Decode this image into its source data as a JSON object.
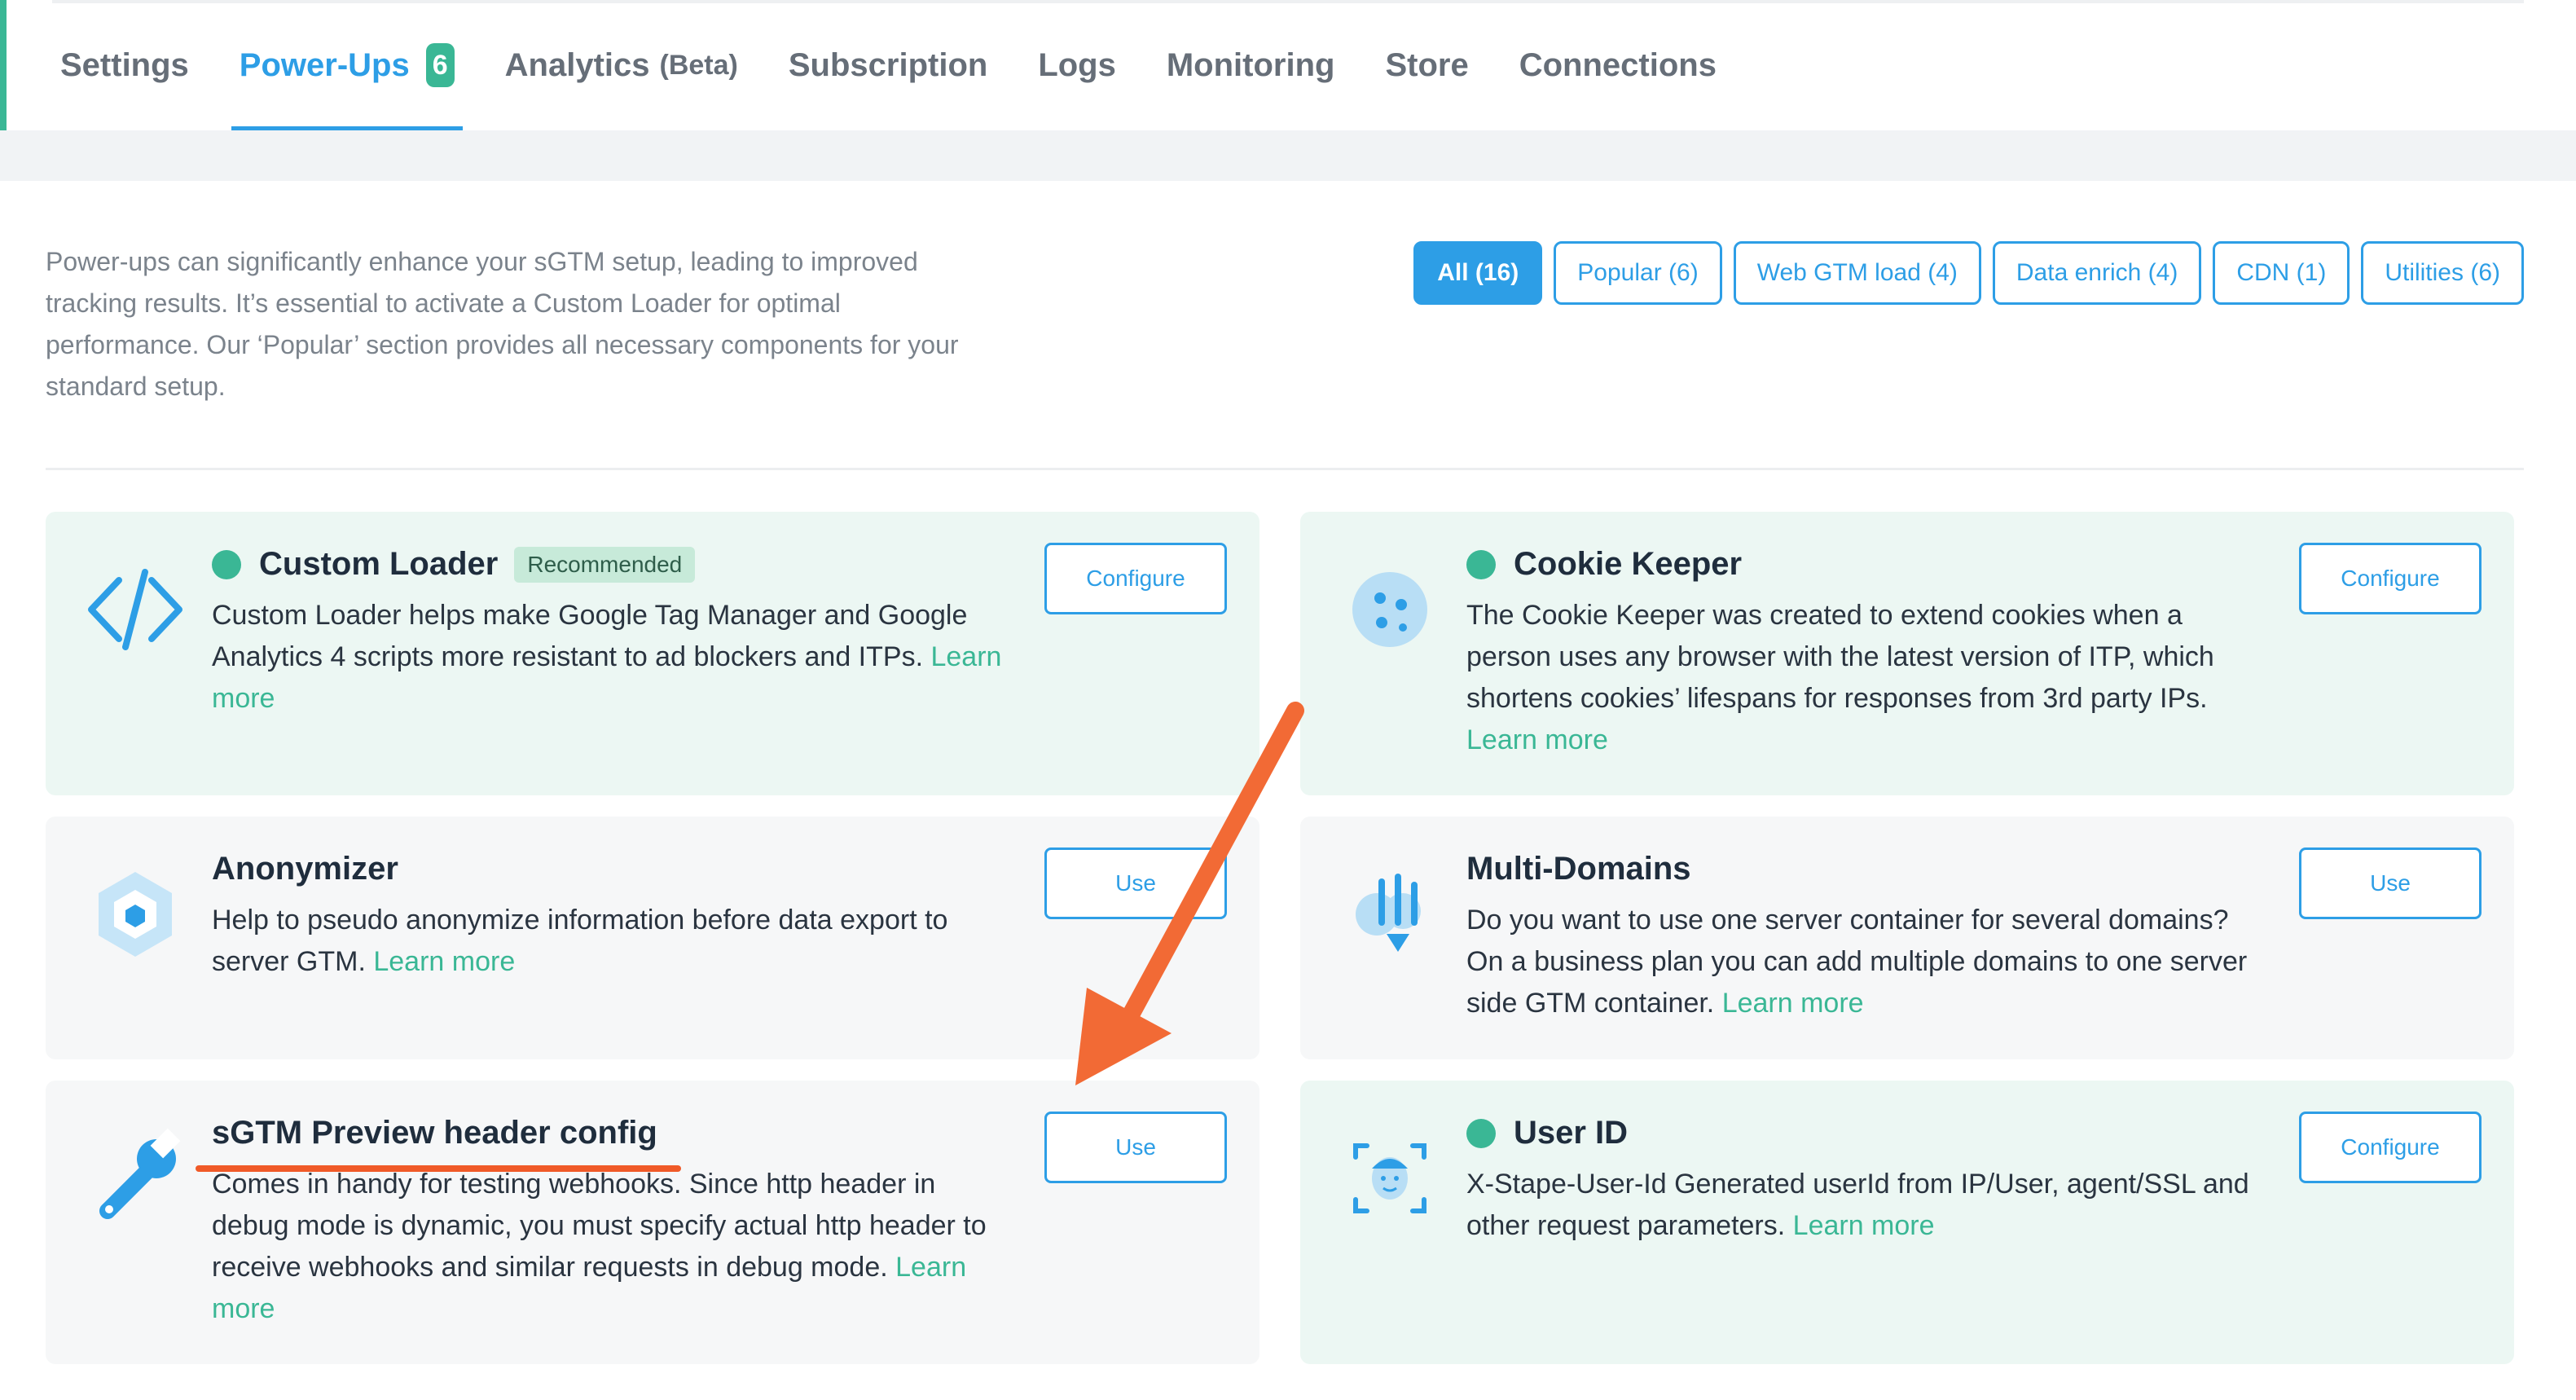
{
  "tabs": [
    {
      "label": "Settings"
    },
    {
      "label": "Power-Ups",
      "badge": "6"
    },
    {
      "label": "Analytics",
      "suffix": "(Beta)"
    },
    {
      "label": "Subscription"
    },
    {
      "label": "Logs"
    },
    {
      "label": "Monitoring"
    },
    {
      "label": "Store"
    },
    {
      "label": "Connections"
    }
  ],
  "intro": "Power-ups can significantly enhance your sGTM setup, leading to improved tracking results. It’s essential to activate a Custom Loader for optimal performance. Our ‘Popular’ section provides all necessary components for your standard setup.",
  "filters": [
    "All (16)",
    "Popular (6)",
    "Web GTM load (4)",
    "Data enrich (4)",
    "CDN (1)",
    "Utilities (6)"
  ],
  "cards": [
    {
      "title": "Custom Loader",
      "badge": "Recommended",
      "desc": "Custom Loader helps make Google Tag Manager and Google Analytics 4 scripts more resistant to ad blockers and ITPs.",
      "learn": "Learn more",
      "button": "Configure"
    },
    {
      "title": "Cookie Keeper",
      "desc": "The Cookie Keeper was created to extend cookies when a person uses any browser with the latest version of ITP, which shortens cookies’ lifespans for responses from 3rd party IPs.",
      "learn": "Learn more",
      "button": "Configure"
    },
    {
      "title": "Anonymizer",
      "desc": "Help to pseudo anonymize information before data export to server GTM.",
      "learn": "Learn more",
      "button": "Use"
    },
    {
      "title": "Multi-Domains",
      "desc": "Do you want to use one server container for several domains? On a business plan you can add multiple domains to one server side GTM container.",
      "learn": "Learn more",
      "button": "Use"
    },
    {
      "title": "sGTM Preview header config",
      "desc": "Comes in handy for testing webhooks. Since http header in debug mode is dynamic, you must specify actual http header to receive webhooks and similar requests in debug mode.",
      "learn": "Learn more",
      "button": "Use"
    },
    {
      "title": "User ID",
      "desc": "X-Stape-User-Id Generated userId from IP/User, agent/SSL and other request parameters.",
      "learn": "Learn more",
      "button": "Configure"
    }
  ],
  "colors": {
    "accent": "#2d9ee6",
    "green": "#3ab795",
    "annotation": "#f05a28"
  }
}
